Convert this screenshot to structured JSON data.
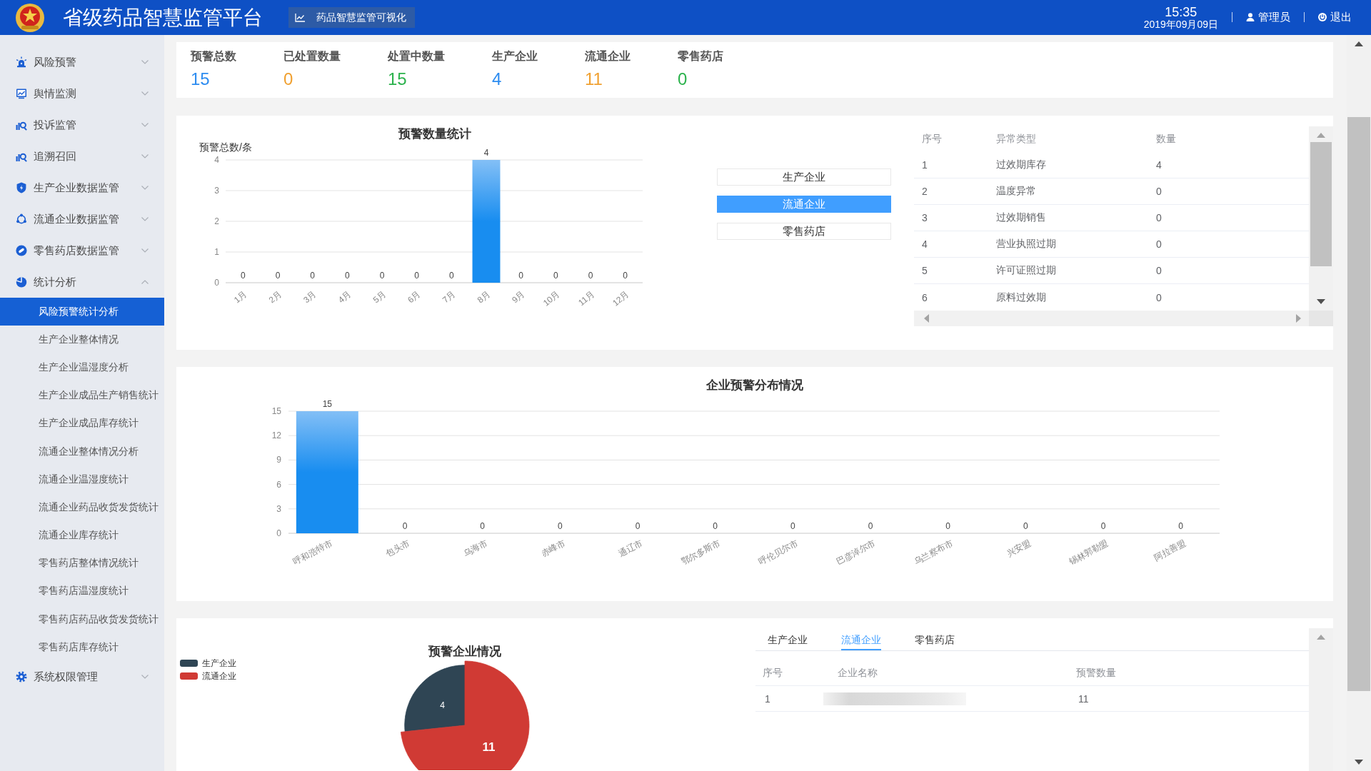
{
  "header": {
    "title": "省级药品智慧监管平台",
    "badge": "药品智慧监管可视化",
    "time": "15:35",
    "date": "2019年09月09日",
    "user": "管理员",
    "logout": "退出"
  },
  "sidebar": {
    "items": [
      {
        "label": "风险预警",
        "expanded": false
      },
      {
        "label": "舆情监测",
        "expanded": false
      },
      {
        "label": "投诉监管",
        "expanded": false
      },
      {
        "label": "追溯召回",
        "expanded": false
      },
      {
        "label": "生产企业数据监管",
        "expanded": false
      },
      {
        "label": "流通企业数据监管",
        "expanded": false
      },
      {
        "label": "零售药店数据监管",
        "expanded": false
      },
      {
        "label": "统计分析",
        "expanded": true,
        "children": [
          {
            "label": "风险预警统计分析",
            "selected": true
          },
          {
            "label": "生产企业整体情况",
            "selected": false
          },
          {
            "label": "生产企业温湿度分析",
            "selected": false
          },
          {
            "label": "生产企业成品生产销售统计",
            "selected": false
          },
          {
            "label": "生产企业成品库存统计",
            "selected": false
          },
          {
            "label": "流通企业整体情况分析",
            "selected": false
          },
          {
            "label": "流通企业温湿度统计",
            "selected": false
          },
          {
            "label": "流通企业药品收货发货统计",
            "selected": false
          },
          {
            "label": "流通企业库存统计",
            "selected": false
          },
          {
            "label": "零售药店整体情况统计",
            "selected": false
          },
          {
            "label": "零售药店温湿度统计",
            "selected": false
          },
          {
            "label": "零售药店药品收货发货统计",
            "selected": false
          },
          {
            "label": "零售药店库存统计",
            "selected": false
          }
        ]
      },
      {
        "label": "系统权限管理",
        "expanded": false
      }
    ]
  },
  "stats": [
    {
      "label": "预警总数",
      "value": "15",
      "color": "#2d8cf0"
    },
    {
      "label": "已处置数量",
      "value": "0",
      "color": "#f0a030"
    },
    {
      "label": "处置中数量",
      "value": "15",
      "color": "#2bb24c"
    },
    {
      "label": "生产企业",
      "value": "4",
      "color": "#2d8cf0"
    },
    {
      "label": "流通企业",
      "value": "11",
      "color": "#f0a030"
    },
    {
      "label": "零售药店",
      "value": "0",
      "color": "#2bb24c"
    }
  ],
  "warning_panel": {
    "chart_data": {
      "type": "bar",
      "title": "预警数量统计",
      "ylabel": "预警总数/条",
      "categories": [
        "1月",
        "2月",
        "3月",
        "4月",
        "5月",
        "6月",
        "7月",
        "8月",
        "9月",
        "10月",
        "11月",
        "12月"
      ],
      "values": [
        0,
        0,
        0,
        0,
        0,
        0,
        0,
        4,
        0,
        0,
        0,
        0
      ],
      "ylim": [
        0,
        4
      ],
      "yticks": [
        {
          "value": 0,
          "label": "0"
        },
        {
          "value": 1,
          "label": "1"
        },
        {
          "value": 2,
          "label": "2"
        },
        {
          "value": 3,
          "label": "3"
        },
        {
          "value": 4,
          "label": "4"
        }
      ],
      "grid": true,
      "value_labels": [
        "0",
        "0",
        "0",
        "0",
        "0",
        "0",
        "0",
        "4",
        "0",
        "0",
        "0",
        "0"
      ]
    },
    "filter_buttons": [
      {
        "label": "生产企业",
        "selected": false
      },
      {
        "label": "流通企业",
        "selected": true
      },
      {
        "label": "零售药店",
        "selected": false
      }
    ],
    "anomaly_table": {
      "columns": [
        "序号",
        "异常类型",
        "数量"
      ],
      "rows": [
        [
          "1",
          "过效期库存",
          "4"
        ],
        [
          "2",
          "温度异常",
          "0"
        ],
        [
          "3",
          "过效期销售",
          "0"
        ],
        [
          "4",
          "营业执照过期",
          "0"
        ],
        [
          "5",
          "许可证照过期",
          "0"
        ],
        [
          "6",
          "原料过效期",
          "0"
        ]
      ]
    }
  },
  "distribution_panel": {
    "chart_data": {
      "type": "bar",
      "title": "企业预警分布情况",
      "categories": [
        "呼和浩特市",
        "包头市",
        "乌海市",
        "赤峰市",
        "通辽市",
        "鄂尔多斯市",
        "呼伦贝尔市",
        "巴彦淖尔市",
        "乌兰察布市",
        "兴安盟",
        "锡林郭勒盟",
        "阿拉善盟"
      ],
      "values": [
        15,
        0,
        0,
        0,
        0,
        0,
        0,
        0,
        0,
        0,
        0,
        0
      ],
      "ylim": [
        0,
        15
      ],
      "yticks": [
        {
          "value": 0,
          "label": "0"
        },
        {
          "value": 3,
          "label": "3"
        },
        {
          "value": 6,
          "label": "6"
        },
        {
          "value": 9,
          "label": "9"
        },
        {
          "value": 12,
          "label": "12"
        },
        {
          "value": 15,
          "label": "15"
        }
      ],
      "grid": true,
      "value_labels": [
        "15",
        "0",
        "0",
        "0",
        "0",
        "0",
        "0",
        "0",
        "0",
        "0",
        "0",
        "0"
      ]
    }
  },
  "enterprise_panel": {
    "chart_data": {
      "type": "pie",
      "title": "预警企业情况",
      "categories": [
        "生产企业",
        "流通企业"
      ],
      "values": [
        4,
        11
      ],
      "colors": [
        "#2f4554",
        "#d03a34"
      ],
      "legend": true,
      "value_labels": [
        "4",
        "11"
      ]
    },
    "tabs": [
      {
        "label": "生产企业",
        "selected": false
      },
      {
        "label": "流通企业",
        "selected": true
      },
      {
        "label": "零售药店",
        "selected": false
      }
    ],
    "table": {
      "columns": [
        "序号",
        "企业名称",
        "预警数量"
      ],
      "rows": [
        [
          "1",
          "",
          "11"
        ]
      ],
      "name_blurred": true
    }
  }
}
